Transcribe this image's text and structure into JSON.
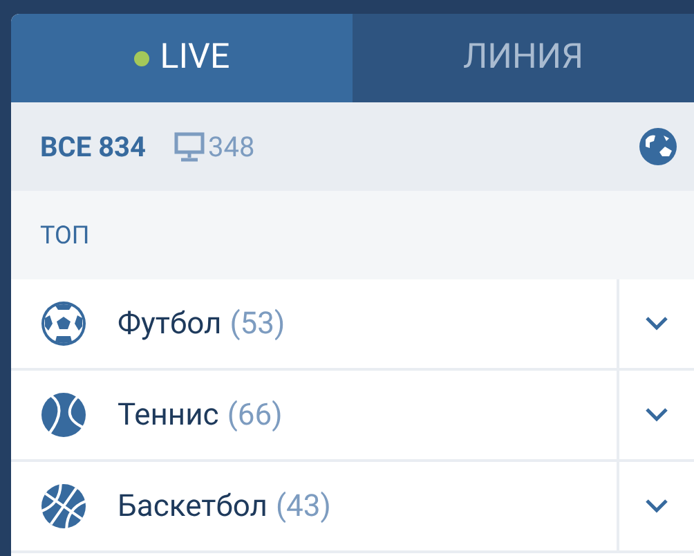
{
  "tabs": [
    {
      "label": "LIVE",
      "selected": true,
      "live_dot": true
    },
    {
      "label": "ЛИНИЯ",
      "selected": false,
      "live_dot": false
    }
  ],
  "filter_bar": {
    "all_label": "ВСЕ 834",
    "stream_count": "348"
  },
  "section": {
    "title": "ТОП"
  },
  "sports": [
    {
      "kind": "football",
      "name": "Футбол",
      "count": "(53)",
      "expanded": false
    },
    {
      "kind": "tennis",
      "name": "Теннис",
      "count": "(66)",
      "expanded": false
    },
    {
      "kind": "basketball",
      "name": "Баскетбол",
      "count": "(43)",
      "expanded": false
    }
  ]
}
